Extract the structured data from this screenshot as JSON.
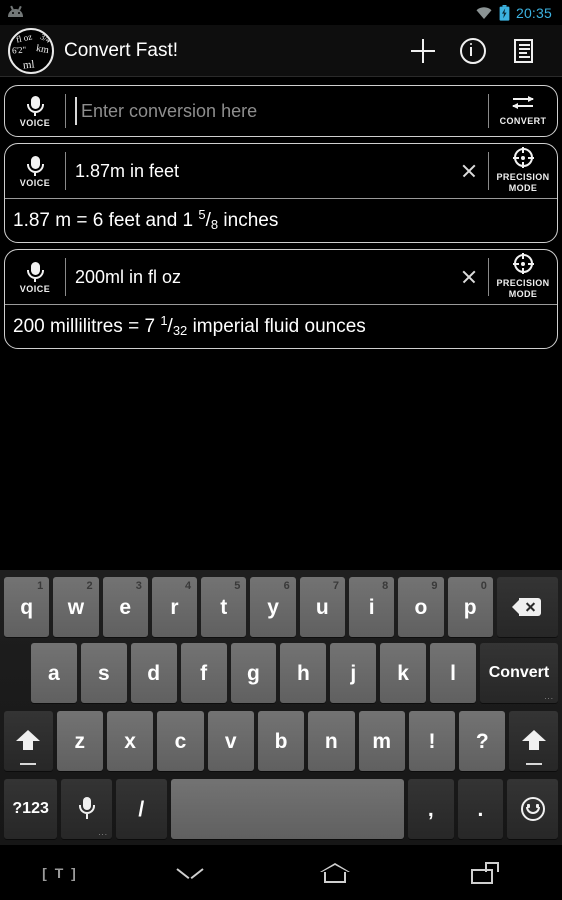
{
  "statusbar": {
    "notification_icon": "android-robot-icon",
    "wifi_icon": "wifi-icon",
    "battery_icon": "battery-charging-icon",
    "clock": "20:35",
    "clock_color": "#3cb2e0"
  },
  "actionbar": {
    "logo_icon": "convert-fast-logo-icon",
    "logo_text": {
      "fl_oz": "fl oz",
      "three_quarters": "3/4",
      "six_two": "6'2\"",
      "km": "km",
      "ml": "ml"
    },
    "title": "Convert Fast!",
    "actions": [
      {
        "name": "add-conversion-button",
        "icon": "plus-icon"
      },
      {
        "name": "info-button",
        "icon": "info-circle-icon"
      },
      {
        "name": "history-button",
        "icon": "list-document-icon"
      }
    ]
  },
  "cards": [
    {
      "voice_label": "VOICE",
      "query_value": "",
      "query_placeholder": "Enter conversion here",
      "has_caret": true,
      "has_clear": false,
      "action_label": "CONVERT",
      "action_icon": "swap-arrows-icon",
      "result": null
    },
    {
      "voice_label": "VOICE",
      "query_value": "1.87m in feet",
      "query_placeholder": "",
      "has_caret": false,
      "has_clear": true,
      "action_label_line1": "PRECISION",
      "action_label_line2": "MODE",
      "action_icon": "crosshair-target-icon",
      "result": {
        "prefix": "1.87 m = 6 feet and 1 ",
        "numerator": "5",
        "denominator": "8",
        "suffix": " inches",
        "plain": "1.87 m = 6 feet and 1 5/8 inches"
      }
    },
    {
      "voice_label": "VOICE",
      "query_value": "200ml in fl oz",
      "query_placeholder": "",
      "has_caret": false,
      "has_clear": true,
      "action_label_line1": "PRECISION",
      "action_label_line2": "MODE",
      "action_icon": "crosshair-target-icon",
      "result": {
        "prefix": "200 millilitres = 7 ",
        "numerator": "1",
        "denominator": "32",
        "suffix": " imperial fluid ounces",
        "plain": "200 millilitres = 7 1/32 imperial fluid ounces"
      }
    }
  ],
  "keyboard": {
    "row1": [
      {
        "label": "q",
        "sup": "1"
      },
      {
        "label": "w",
        "sup": "2"
      },
      {
        "label": "e",
        "sup": "3"
      },
      {
        "label": "r",
        "sup": "4"
      },
      {
        "label": "t",
        "sup": "5"
      },
      {
        "label": "y",
        "sup": "6"
      },
      {
        "label": "u",
        "sup": "7"
      },
      {
        "label": "i",
        "sup": "8"
      },
      {
        "label": "o",
        "sup": "9"
      },
      {
        "label": "p",
        "sup": "0"
      }
    ],
    "backspace_icon": "backspace-icon",
    "row2": [
      {
        "label": "a"
      },
      {
        "label": "s"
      },
      {
        "label": "d"
      },
      {
        "label": "f"
      },
      {
        "label": "g"
      },
      {
        "label": "h"
      },
      {
        "label": "j"
      },
      {
        "label": "k"
      },
      {
        "label": "l"
      }
    ],
    "convert_key_label": "Convert",
    "convert_key_dots": "...",
    "row3": [
      {
        "label": "z"
      },
      {
        "label": "x"
      },
      {
        "label": "c"
      },
      {
        "label": "v"
      },
      {
        "label": "b"
      },
      {
        "label": "n"
      },
      {
        "label": "m"
      },
      {
        "label": "!"
      },
      {
        "label": "?"
      }
    ],
    "shift_left_icon": "shift-icon",
    "shift_right_icon": "shift-icon",
    "row4": {
      "symbols_label": "?123",
      "mic_icon": "microphone-icon",
      "mic_dots": "...",
      "slash_label": "/",
      "space_label": "",
      "comma_label": ",",
      "period_label": ".",
      "emoji_icon": "emoji-smiley-icon"
    }
  },
  "navbar": {
    "ime_label": "[ T ]",
    "back_icon": "chevron-down-icon",
    "home_icon": "home-icon",
    "recents_icon": "recent-apps-icon"
  }
}
